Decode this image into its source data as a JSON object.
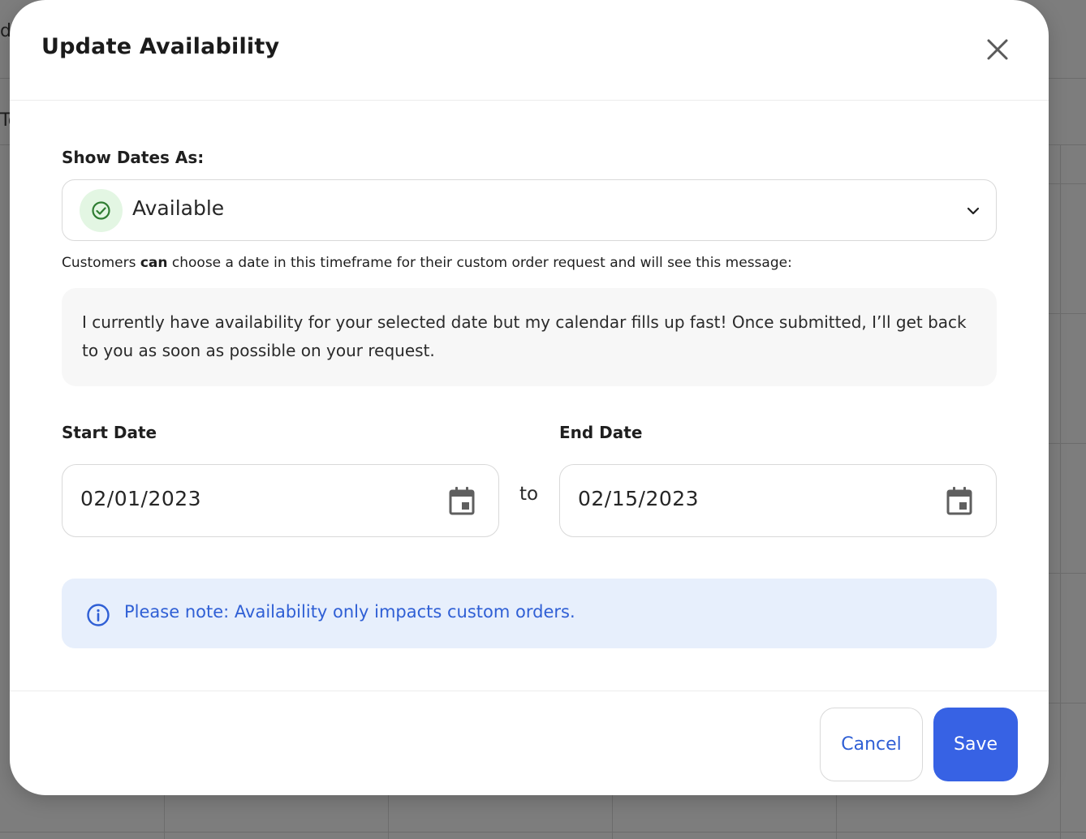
{
  "background": {
    "edge_texts": [
      "d",
      "To"
    ]
  },
  "modal": {
    "title": "Update Availability",
    "show_dates_label": "Show Dates As:",
    "status": {
      "value": "Available",
      "icon": "check-circle-icon",
      "color": "#2f7d32",
      "bg_color": "#e3f6e3"
    },
    "helper": {
      "prefix": "Customers ",
      "emphasis": "can",
      "suffix": " choose a date in this timeframe for their custom order request and will see this message:"
    },
    "message": "I currently have availability for your selected date but my calendar fills up fast! Once submitted, I’ll get back to you as soon as possible on your request.",
    "start_date": {
      "label": "Start Date",
      "value": "02/01/2023"
    },
    "end_date": {
      "label": "End Date",
      "value": "02/15/2023"
    },
    "range_separator": "to",
    "note": "Please note: Availability only impacts custom orders.",
    "buttons": {
      "cancel": "Cancel",
      "save": "Save"
    },
    "colors": {
      "accent": "#3762e4",
      "note_bg": "#e7effc",
      "note_text": "#2f5fd5"
    }
  }
}
